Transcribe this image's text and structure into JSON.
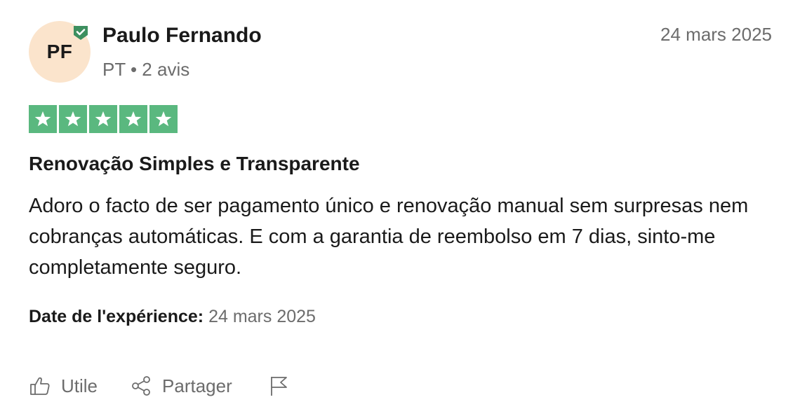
{
  "reviewer": {
    "initials": "PF",
    "name": "Paulo Fernando",
    "meta": "PT • 2 avis",
    "verified_icon": "verified-check-icon"
  },
  "review": {
    "date": "24 mars 2025",
    "rating": 5,
    "rating_max": 5,
    "title": "Renovação Simples e Transparente",
    "body": "Adoro o facto de ser pagamento único e renovação manual sem surpresas nem cobranças automáticas. E com a garantia de reembolso em 7 dias, sinto-me completamente seguro.",
    "experience_label": "Date de l'expérience:",
    "experience_date": "24 mars 2025"
  },
  "actions": {
    "useful_label": "Utile",
    "share_label": "Partager",
    "useful_icon": "thumbs-up-icon",
    "share_icon": "share-icon",
    "report_icon": "flag-icon"
  },
  "colors": {
    "star_bg": "#5ab87f",
    "avatar_bg": "#fbe4cc",
    "verified": "#3d8f5f",
    "muted_text": "#6c6c6c"
  }
}
